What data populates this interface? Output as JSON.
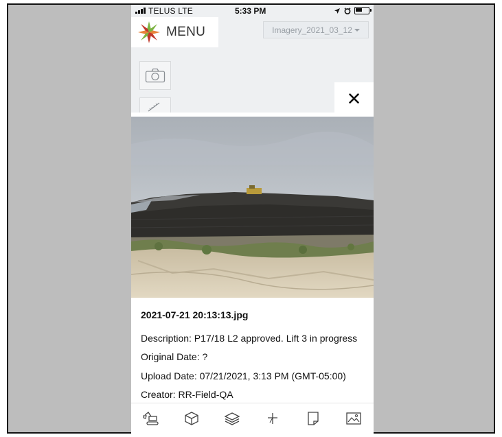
{
  "status_bar": {
    "carrier": "TELUS  LTE",
    "time": "5:33 PM"
  },
  "header": {
    "menu_label": "MENU",
    "imagery_select": "Imagery_2021_03_12"
  },
  "toolbar": {
    "camera_icon": "camera-icon",
    "ruler_icon": "ruler-icon"
  },
  "photo_viewer": {
    "close_label": "✕",
    "photo_icon": "construction-site-photo"
  },
  "photo_info": {
    "filename": "2021-07-21 20:13:13.jpg",
    "description": "Description: P17/18 L2 approved. Lift 3 in progress",
    "original_date": "Original Date: ?",
    "upload_date": "Upload Date: 07/21/2021, 3:13 PM (GMT-05:00)",
    "creator": "Creator: RR-Field-QA"
  },
  "bottom_tabs": [
    {
      "icon": "excavator-icon"
    },
    {
      "icon": "cube-icon"
    },
    {
      "icon": "layers-icon"
    },
    {
      "icon": "crosshair-icon"
    },
    {
      "icon": "note-icon"
    },
    {
      "icon": "image-icon"
    }
  ],
  "colors": {
    "background_frame": "#bdbdbd",
    "map_background": "#eef0f2",
    "logo_green": "#7cb342",
    "logo_orange": "#e8833a",
    "logo_red": "#c0392b"
  }
}
